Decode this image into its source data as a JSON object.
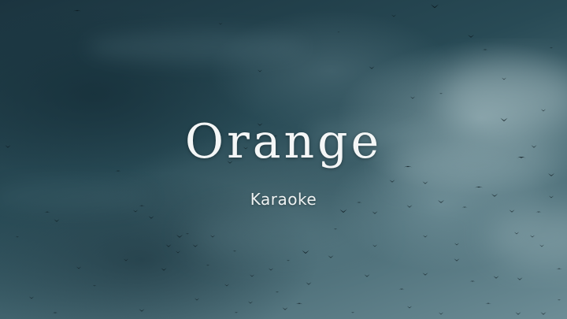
{
  "title": "Orange",
  "subtitle": "Karaoke",
  "background": {
    "description_icon": "cloudy-sky-with-flying-birds",
    "colors": {
      "sky_dark": "#1b343f",
      "sky_mid": "#284a55",
      "sky_light": "#6d8d96",
      "text": "#f4f6f6"
    }
  }
}
